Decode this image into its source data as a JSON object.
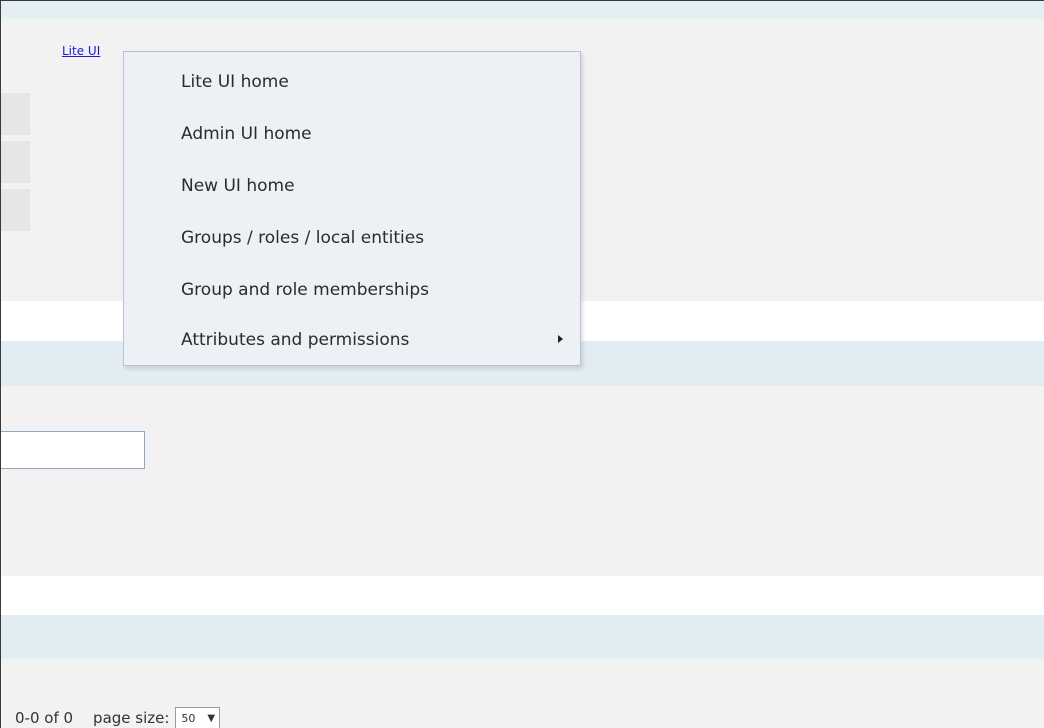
{
  "header": {
    "nav_link": "Lite UI"
  },
  "menu": {
    "items": [
      {
        "label": "Lite UI home"
      },
      {
        "label": "Admin UI home"
      },
      {
        "label": "New UI home"
      },
      {
        "label": "Groups / roles / local entities"
      },
      {
        "label": "Group and role memberships"
      },
      {
        "label": "Attributes and permissions",
        "has_submenu": true
      }
    ]
  },
  "filter": {
    "value": ""
  },
  "pager": {
    "range": "0-0 of 0",
    "page_size_label": "page size:",
    "page_size_value": "50",
    "dropdown_arrow": "▼"
  }
}
